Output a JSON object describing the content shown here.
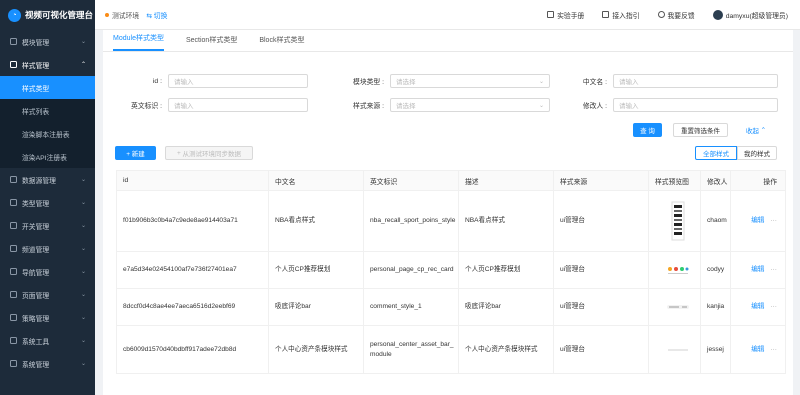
{
  "app": {
    "title": "视频可视化管理台"
  },
  "topbar": {
    "env_label": "测试环境",
    "switch_label": "切换",
    "links": [
      {
        "label": "实验手册",
        "icon": "book-icon"
      },
      {
        "label": "接入指引",
        "icon": "guide-icon"
      },
      {
        "label": "我要反馈",
        "icon": "feedback-icon"
      }
    ],
    "user": "damyxu(超级管理员)"
  },
  "sidebar": {
    "items": [
      {
        "label": "模块管理",
        "open": false
      },
      {
        "label": "样式管理",
        "open": true,
        "children": [
          {
            "label": "样式类型",
            "active": true
          },
          {
            "label": "样式列表",
            "active": false
          },
          {
            "label": "渲染脚本注册表",
            "active": false
          },
          {
            "label": "渲染API注册表",
            "active": false
          }
        ]
      },
      {
        "label": "数据源管理",
        "open": false
      },
      {
        "label": "类型管理",
        "open": false
      },
      {
        "label": "开关管理",
        "open": false
      },
      {
        "label": "频道管理",
        "open": false
      },
      {
        "label": "导航管理",
        "open": false
      },
      {
        "label": "页面管理",
        "open": false
      },
      {
        "label": "策略管理",
        "open": false
      },
      {
        "label": "系统工具",
        "open": false
      },
      {
        "label": "系统管理",
        "open": false
      }
    ]
  },
  "tabs": [
    "Module样式类型",
    "Section样式类型",
    "Block样式类型"
  ],
  "filters": {
    "id": {
      "label": "id :",
      "placeholder": "请输入"
    },
    "module_type": {
      "label": "模块类型 :",
      "placeholder": "请选择"
    },
    "cn_name": {
      "label": "中文名 :",
      "placeholder": "请输入"
    },
    "en_id": {
      "label": "英文标识 :",
      "placeholder": "请输入"
    },
    "style_source": {
      "label": "样式来源 :",
      "placeholder": "请选择"
    },
    "modifier": {
      "label": "修改人 :",
      "placeholder": "请输入"
    }
  },
  "actions": {
    "query": "查 询",
    "reset": "重置筛选条件",
    "collapse": "收起",
    "new": "+ 新建",
    "sync": "从测试环境同步数据",
    "all_styles": "全部样式",
    "my_styles": "我的样式"
  },
  "table": {
    "columns": [
      "id",
      "中文名",
      "英文标识",
      "描述",
      "样式来源",
      "样式预览图",
      "修改人",
      "操作"
    ],
    "rows": [
      {
        "id": "f01b906b3c0b4a7c9ede8ae914403a71",
        "cn": "NBA看点样式",
        "en": "nba_recall_sport_poins_style",
        "desc": "NBA看点样式",
        "source": "ui管理台",
        "modifier": "chaom",
        "edit": "编辑",
        "more": "···"
      },
      {
        "id": "e7a5d34e02454100af7e736f27401ea7",
        "cn": "个人页CP推荐模划",
        "en": "personal_page_cp_rec_card",
        "desc": "个人页CP推荐模划",
        "source": "ui管理台",
        "modifier": "codyy",
        "edit": "编辑",
        "more": "···"
      },
      {
        "id": "8dccf0d4c8ae4ee7aeca6516d2eebf69",
        "cn": "吸底评论bar",
        "en": "comment_style_1",
        "desc": "吸底评论bar",
        "source": "ui管理台",
        "modifier": "kanjia",
        "edit": "编辑",
        "more": "···"
      },
      {
        "id": "cb6009d1570d40bdbff917adee72db8d",
        "cn": "个人中心资产条模块样式",
        "en": "personal_center_asset_bar_module",
        "desc": "个人中心资产条模块样式",
        "source": "ui管理台",
        "modifier": "jessej",
        "edit": "编辑",
        "more": "···"
      }
    ]
  }
}
